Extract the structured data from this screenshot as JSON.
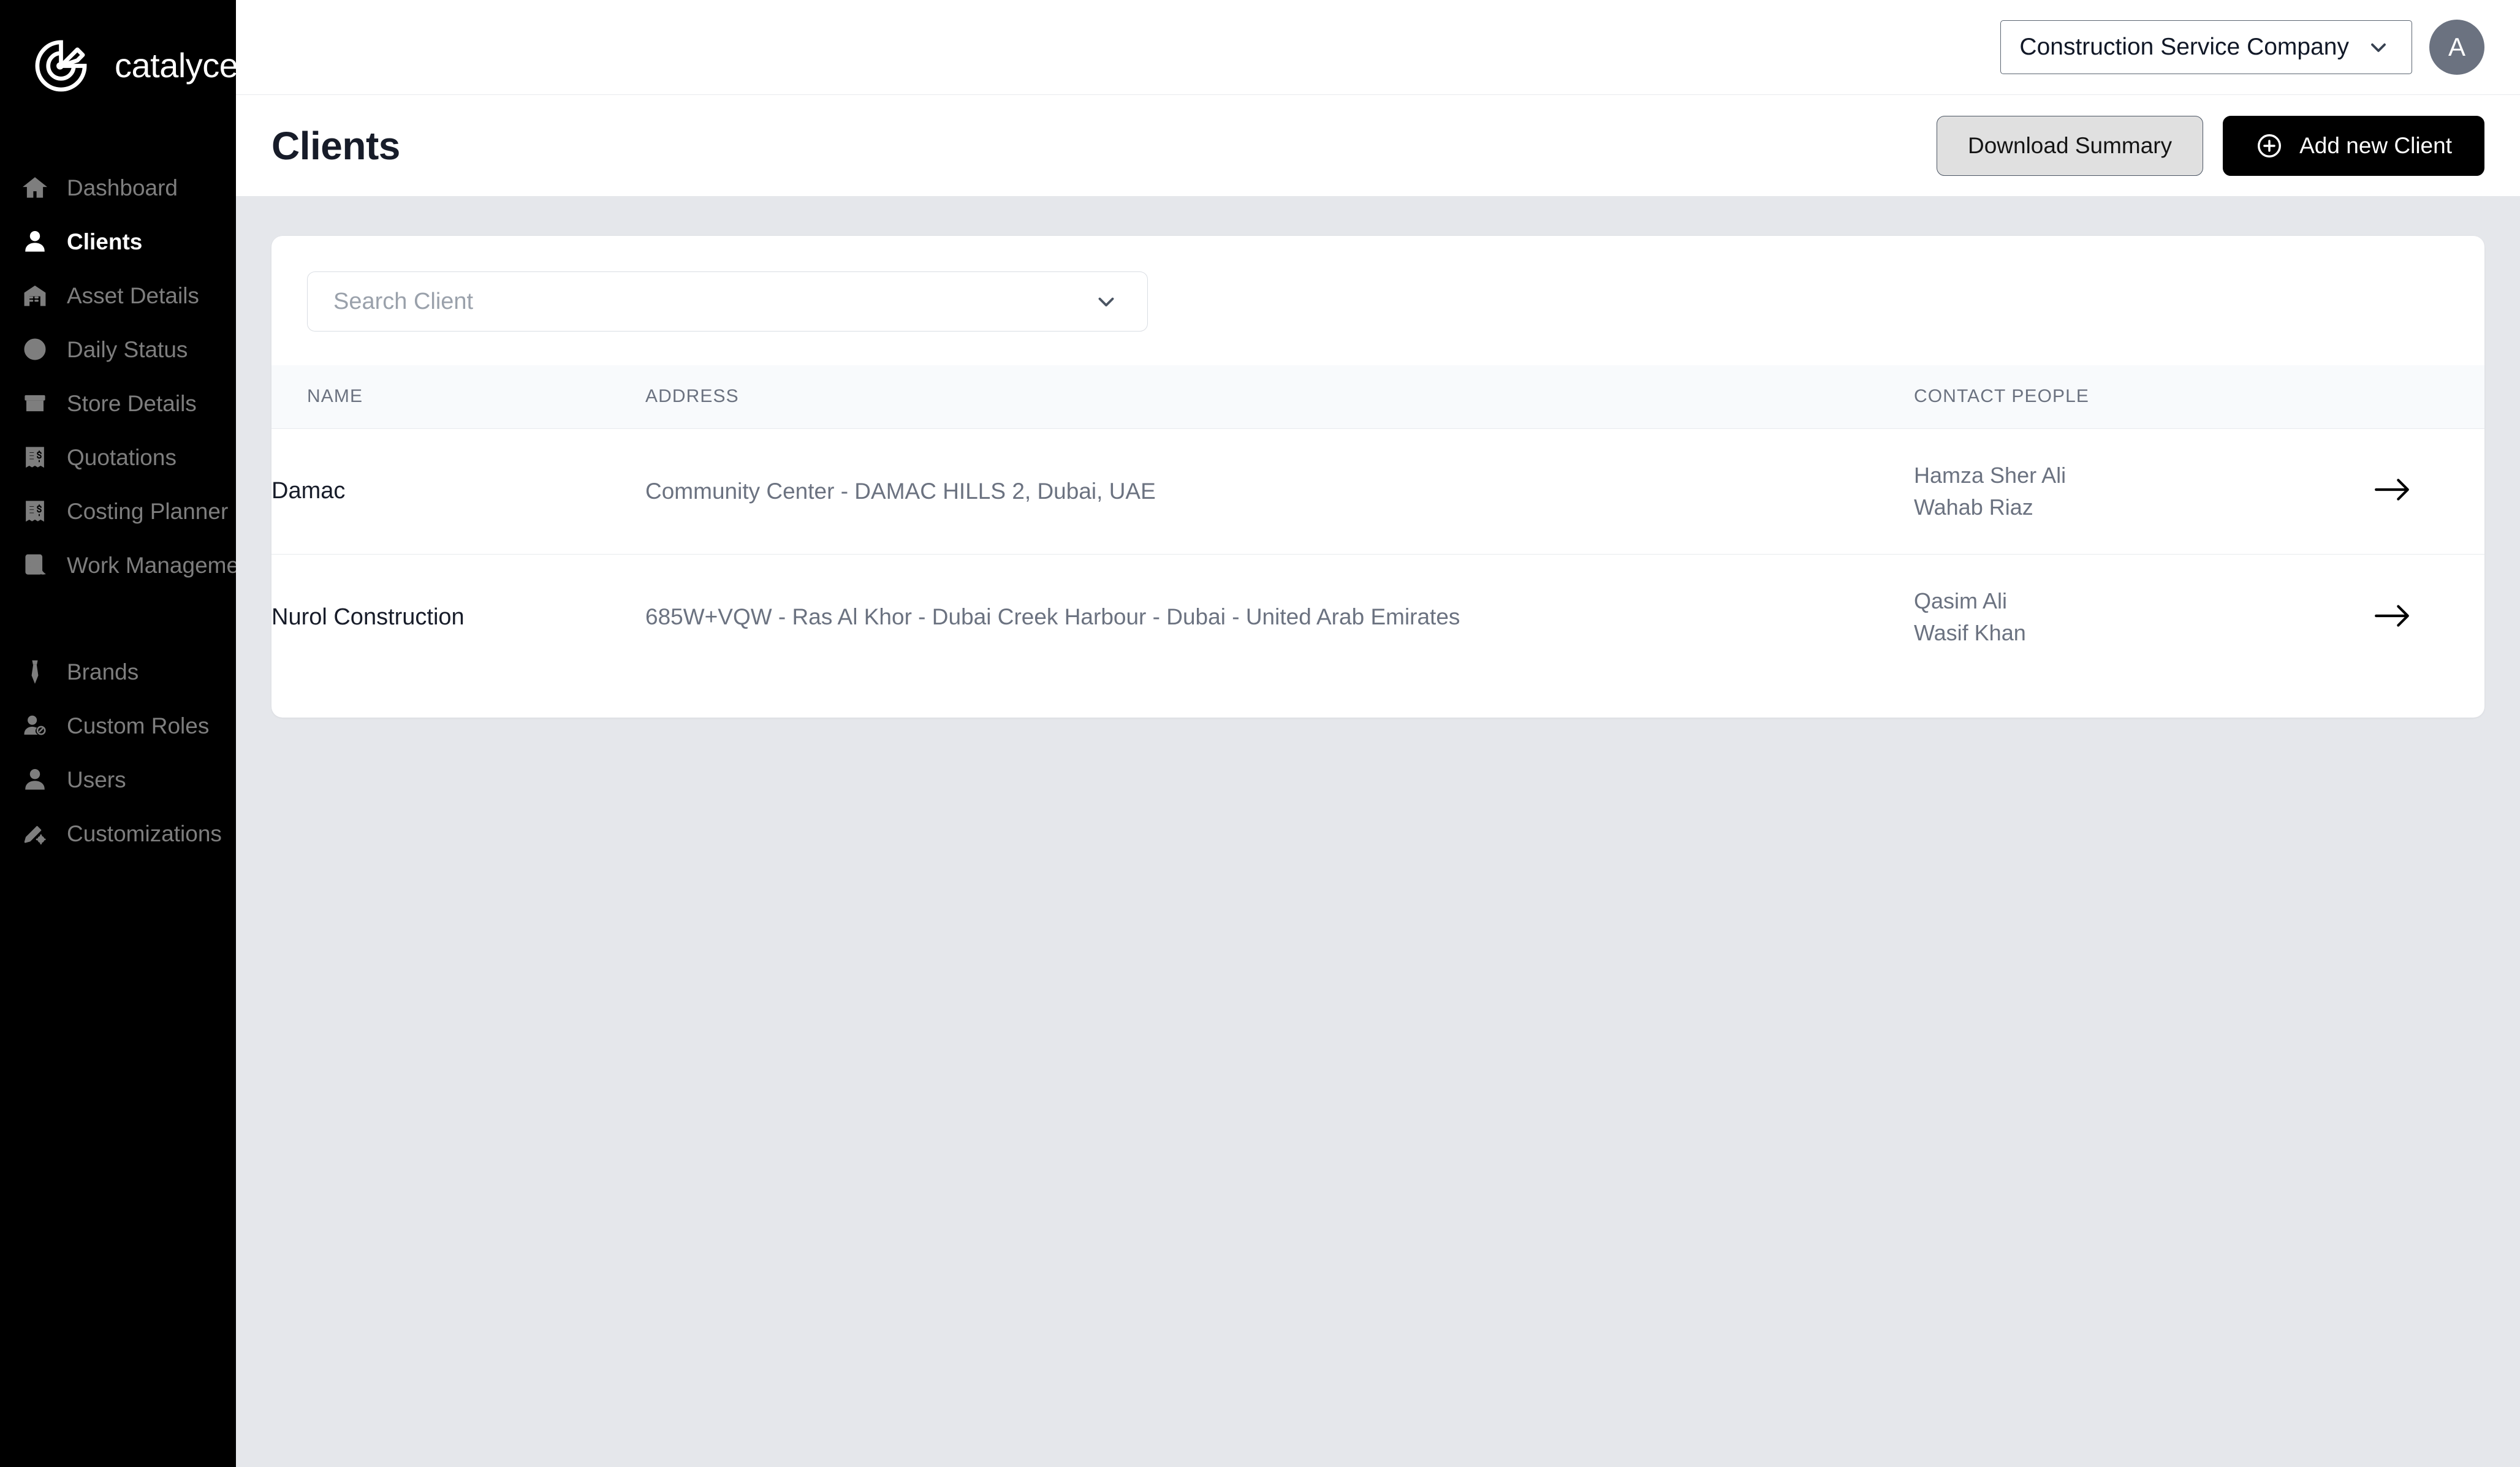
{
  "brand": {
    "name": "catalyces",
    "logo_icon": "catalyces-pie-pencil-logo"
  },
  "sidebar": {
    "primary_items": [
      {
        "label": "Dashboard",
        "icon": "home-icon",
        "active": false
      },
      {
        "label": "Clients",
        "icon": "person-icon",
        "active": true
      },
      {
        "label": "Asset Details",
        "icon": "warehouse-icon",
        "active": false
      },
      {
        "label": "Daily Status",
        "icon": "clock-icon",
        "active": false
      },
      {
        "label": "Store Details",
        "icon": "box-icon",
        "active": false
      },
      {
        "label": "Quotations",
        "icon": "receipt-dollar-icon",
        "active": false
      },
      {
        "label": "Costing Planner",
        "icon": "receipt-dollar-icon",
        "active": false
      },
      {
        "label": "Work Management",
        "icon": "checklist-icon",
        "active": false
      }
    ],
    "secondary_items": [
      {
        "label": "Brands",
        "icon": "tie-icon",
        "active": false
      },
      {
        "label": "Custom Roles",
        "icon": "person-edit-icon",
        "active": false
      },
      {
        "label": "Users",
        "icon": "person-icon",
        "active": false
      },
      {
        "label": "Customizations",
        "icon": "pencil-gear-icon",
        "active": false
      }
    ]
  },
  "topbar": {
    "company_selector": {
      "value": "Construction Service Company",
      "icon": "chevron-down-icon"
    },
    "avatar": {
      "initial": "A"
    }
  },
  "page": {
    "title": "Clients",
    "buttons": {
      "download_summary": "Download Summary",
      "add_new_client": "Add new Client",
      "add_icon": "plus-circle-icon"
    }
  },
  "search": {
    "placeholder": "Search Client",
    "value": "",
    "icon": "chevron-down-icon"
  },
  "table": {
    "columns": [
      "NAME",
      "ADDRESS",
      "CONTACT PEOPLE"
    ],
    "rows": [
      {
        "name": "Damac",
        "address": "Community Center - DAMAC HILLS 2, Dubai, UAE",
        "contact_people": [
          "Hamza Sher Ali",
          "Wahab Riaz"
        ],
        "go_icon": "arrow-right-icon"
      },
      {
        "name": "Nurol Construction",
        "address": "685W+VQW - Ras Al Khor - Dubai Creek Harbour - Dubai - United Arab Emirates",
        "contact_people": [
          "Qasim Ali",
          "Wasif Khan"
        ],
        "go_icon": "arrow-right-icon"
      }
    ]
  },
  "colors": {
    "sidebar_bg": "#000000",
    "sidebar_text": "#7e7e7e",
    "sidebar_text_active": "#ffffff",
    "page_bg": "#e5e7eb",
    "card_bg": "#ffffff",
    "primary_button_bg": "#000000",
    "secondary_button_bg": "#e0e0e0",
    "avatar_bg": "#6b7280",
    "table_header_bg": "#f8fafc",
    "muted_text": "#6b7280",
    "title_text": "#171c29"
  }
}
